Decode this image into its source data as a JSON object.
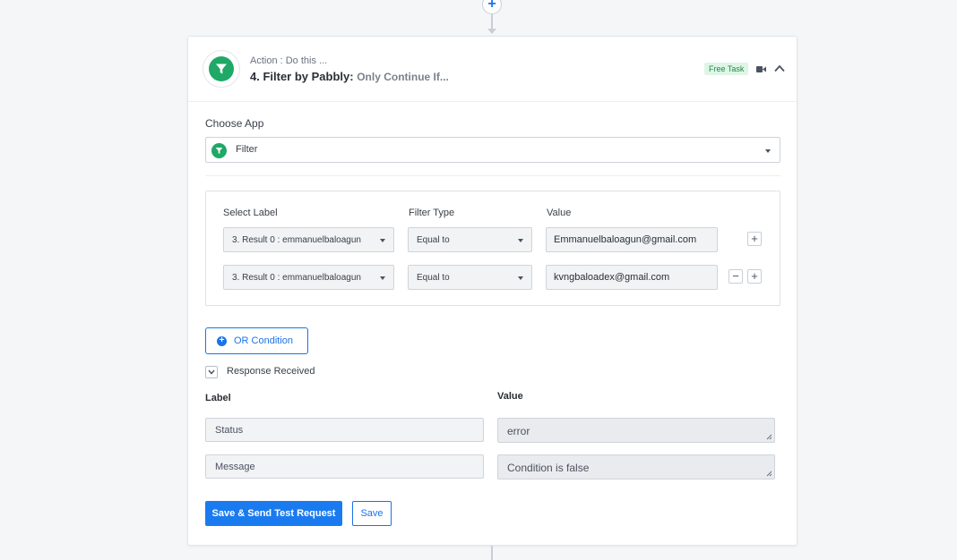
{
  "canvas": {
    "add_step_symbol": "+"
  },
  "header": {
    "action_label": "Action : Do this ...",
    "step_title": "4. Filter by Pabbly:",
    "step_subtitle": "Only Continue If...",
    "badge": "Free Task",
    "brand_color": "#1fa866"
  },
  "choose_app": {
    "label": "Choose App",
    "selected": "Filter"
  },
  "filter": {
    "columns": {
      "select_label": "Select Label",
      "filter_type": "Filter Type",
      "value": "Value"
    },
    "rows": [
      {
        "label": "3. Result 0 : emmanuelbaloagun",
        "type": "Equal to",
        "value": "Emmanuelbaloagun@gmail.com"
      },
      {
        "label": "3. Result 0 : emmanuelbaloagun",
        "type": "Equal to",
        "value": "kvngbaloadex@gmail.com"
      }
    ],
    "add_symbol": "+",
    "remove_symbol": "−"
  },
  "or_condition": {
    "label": "OR Condition",
    "icon_symbol": "+"
  },
  "response": {
    "toggle_label": "Response Received",
    "label_header": "Label",
    "value_header": "Value",
    "rows": [
      {
        "label": "Status",
        "value": "error"
      },
      {
        "label": "Message",
        "value": "Condition is false"
      }
    ]
  },
  "actions": {
    "save_send_label": "Save & Send Test Request",
    "save_label": "Save"
  }
}
